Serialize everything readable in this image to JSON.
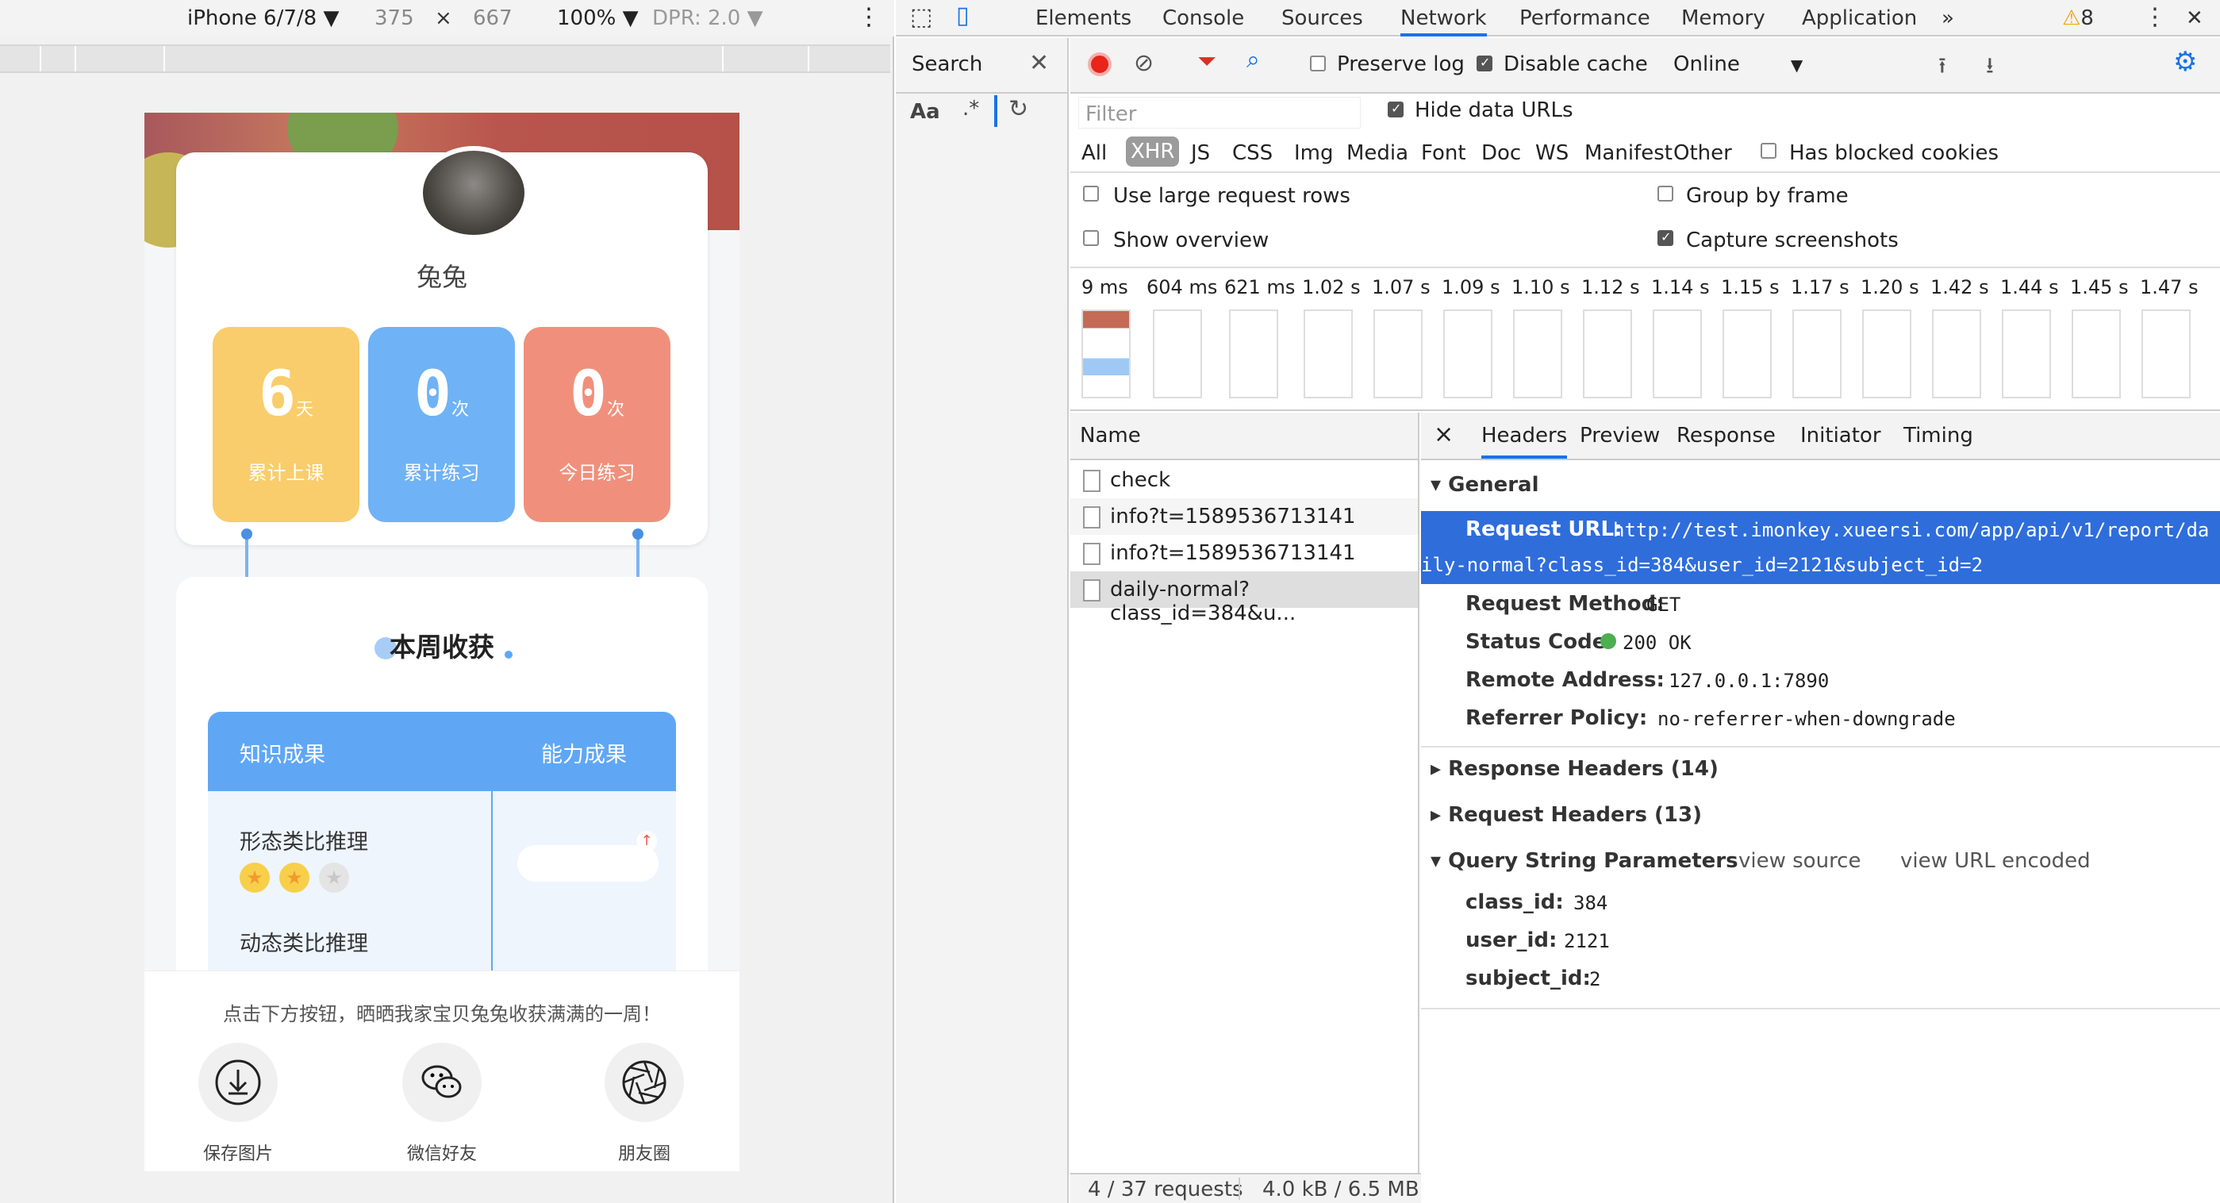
{
  "device_toolbar": {
    "device": "iPhone 6/7/8",
    "width": "375",
    "times": "×",
    "height": "667",
    "zoom": "100%",
    "dpr": "DPR: 2.0"
  },
  "app": {
    "username": "兔兔",
    "stats": [
      {
        "num": "6",
        "unit": "天",
        "label": "累计上课"
      },
      {
        "num": "0",
        "unit": "次",
        "label": "累计练习"
      },
      {
        "num": "0",
        "unit": "次",
        "label": "今日练习"
      }
    ],
    "week_title": "本周收获",
    "table_headers": [
      "知识成果",
      "能力成果"
    ],
    "items": [
      "形态类比推理",
      "动态类比推理"
    ],
    "item1_stars_filled": 2,
    "item1_stars_total": 3,
    "share_text": "点击下方按钮，晒晒我家宝贝兔兔收获满满的一周！",
    "share_buttons": [
      "保存图片",
      "微信好友",
      "朋友圈"
    ],
    "colors": {
      "yellow": "#f9cd6b",
      "blue": "#6fb2f6",
      "red": "#f0907c",
      "accent": "#5fa7f5"
    }
  },
  "devtools": {
    "tabs": [
      "Elements",
      "Console",
      "Sources",
      "Network",
      "Performance",
      "Memory",
      "Application"
    ],
    "more_tabs": "»",
    "warnings": "8",
    "search_label": "Search",
    "search_case": "Aa",
    "search_regex": ".*",
    "preserve_log": "Preserve log",
    "disable_cache": "Disable cache",
    "throttle": "Online",
    "filter_placeholder": "Filter",
    "hide_data_urls": "Hide data URLs",
    "types": [
      "All",
      "XHR",
      "JS",
      "CSS",
      "Img",
      "Media",
      "Font",
      "Doc",
      "WS",
      "Manifest",
      "Other"
    ],
    "has_blocked": "Has blocked cookies",
    "large_rows": "Use large request rows",
    "group_frame": "Group by frame",
    "show_overview": "Show overview",
    "capture_screens": "Capture screenshots",
    "timeline": [
      "9 ms",
      "604 ms",
      "621 ms",
      "1.02 s",
      "1.07 s",
      "1.09 s",
      "1.10 s",
      "1.12 s",
      "1.14 s",
      "1.15 s",
      "1.17 s",
      "1.20 s",
      "1.42 s",
      "1.44 s",
      "1.45 s",
      "1.47 s"
    ],
    "name_header": "Name",
    "requests": [
      "check",
      "info?t=1589536713141",
      "info?t=1589536713141",
      "daily-normal?class_id=384&u..."
    ],
    "detail_tabs": [
      "Headers",
      "Preview",
      "Response",
      "Initiator",
      "Timing"
    ],
    "close": "×",
    "general": "General",
    "request_url_label": "Request URL:",
    "request_url_1": "http://test.imonkey.xueersi.com/app/api/v1/report/da",
    "request_url_2": "ily-normal?class_id=384&user_id=2121&subject_id=2",
    "method_label": "Request Method:",
    "method": "GET",
    "status_label": "Status Code:",
    "status": "200 OK",
    "remote_label": "Remote Address:",
    "remote": "127.0.0.1:7890",
    "referrer_label": "Referrer Policy:",
    "referrer": "no-referrer-when-downgrade",
    "response_headers": "Response Headers (14)",
    "request_headers": "Request Headers (13)",
    "query_params": "Query String Parameters",
    "view_source": "view source",
    "view_url_encoded": "view URL encoded",
    "params": [
      {
        "k": "class_id:",
        "v": "384"
      },
      {
        "k": "user_id:",
        "v": "2121"
      },
      {
        "k": "subject_id:",
        "v": "2"
      }
    ],
    "status_requests": "4 / 37 requests",
    "status_size": "4.0 kB / 6.5 MB"
  }
}
